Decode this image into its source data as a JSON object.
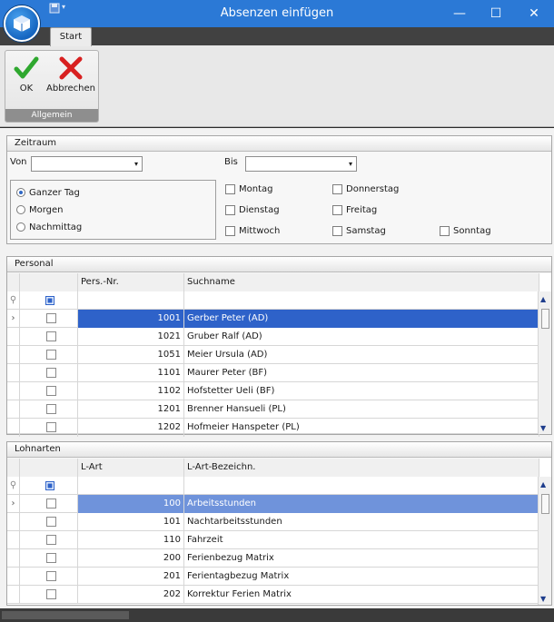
{
  "window": {
    "title": "Absenzen einfügen",
    "minimize": "—",
    "maximize": "☐",
    "close": "✕"
  },
  "ribbon": {
    "tab": "Start",
    "group_label": "Allgemein",
    "ok_label": "OK",
    "cancel_label": "Abbrechen",
    "colors": {
      "ok": "#2fa82f",
      "cancel": "#d82020"
    }
  },
  "zeitraum": {
    "header": "Zeitraum",
    "von_label": "Von",
    "von_value": "",
    "bis_label": "Bis",
    "bis_value": "",
    "radios": [
      {
        "label": "Ganzer Tag",
        "selected": true
      },
      {
        "label": "Morgen",
        "selected": false
      },
      {
        "label": "Nachmittag",
        "selected": false
      }
    ],
    "days": [
      "Montag",
      "Donnerstag",
      "Dienstag",
      "Freitag",
      "Mittwoch",
      "Samstag",
      "Sonntag"
    ]
  },
  "personal": {
    "header": "Personal",
    "columns": [
      "Pers.-Nr.",
      "Suchname"
    ],
    "rows": [
      {
        "nr": "1001",
        "name": "Gerber Peter (AD)"
      },
      {
        "nr": "1021",
        "name": "Gruber Ralf (AD)"
      },
      {
        "nr": "1051",
        "name": "Meier Ursula (AD)"
      },
      {
        "nr": "1101",
        "name": "Maurer Peter (BF)"
      },
      {
        "nr": "1102",
        "name": "Hofstetter Ueli (BF)"
      },
      {
        "nr": "1201",
        "name": "Brenner Hansueli (PL)"
      },
      {
        "nr": "1202",
        "name": "Hofmeier Hanspeter (PL)"
      }
    ]
  },
  "lohnarten": {
    "header": "Lohnarten",
    "columns": [
      "L-Art",
      "L-Art-Bezeichn."
    ],
    "rows": [
      {
        "nr": "100",
        "name": "Arbeitsstunden"
      },
      {
        "nr": "101",
        "name": "Nachtarbeitsstunden"
      },
      {
        "nr": "110",
        "name": "Fahrzeit"
      },
      {
        "nr": "200",
        "name": "Ferienbezug Matrix"
      },
      {
        "nr": "201",
        "name": "Ferientagbezug Matrix"
      },
      {
        "nr": "202",
        "name": "Korrektur Ferien Matrix"
      }
    ]
  },
  "icons": {
    "filter": "filter-icon",
    "row_indicator": "row-indicator-icon",
    "select_all": "select-all-icon"
  }
}
